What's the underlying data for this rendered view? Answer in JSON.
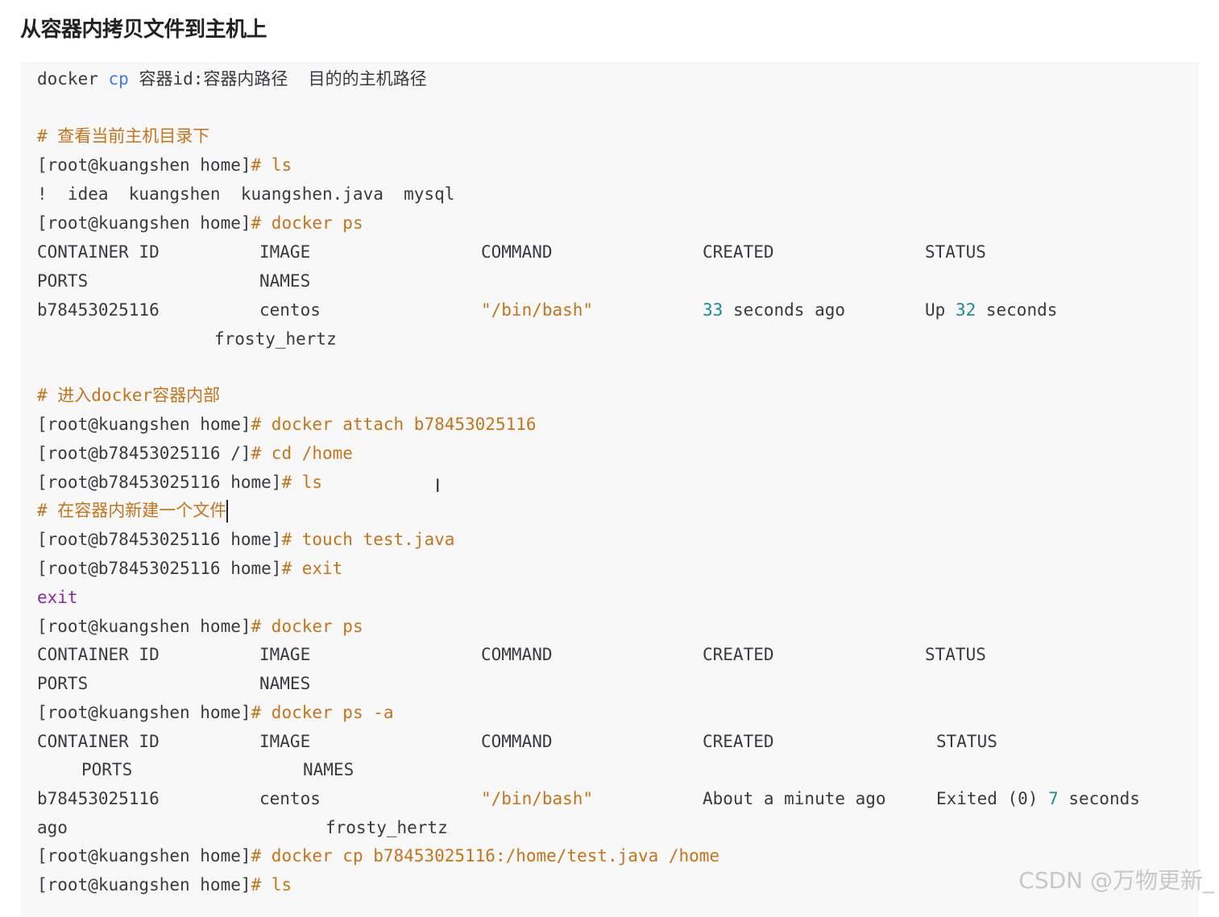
{
  "heading": "从容器内拷贝文件到主机上",
  "code": {
    "l1": {
      "a": "docker ",
      "kw": "cp",
      "b": " 容器id:容器内路径  目的的主机路径"
    },
    "l2": "# 查看当前主机目录下",
    "l3": {
      "prompt": "[root@kuangshen home]",
      "cmd": "# ls"
    },
    "l4": "!  idea  kuangshen  kuangshen.java  mysql",
    "l5": {
      "prompt": "[root@kuangshen home]",
      "cmd": "# docker ps"
    },
    "hdr": {
      "c1": "CONTAINER ID",
      "c2": "IMAGE",
      "c3": "COMMAND",
      "c4": "CREATED",
      "c5": "STATUS",
      "c6": "PORTS",
      "c7": "NAMES"
    },
    "row1": {
      "id": "b78453025116",
      "image": "centos",
      "command": "\"/bin/bash\"",
      "created_num": "33",
      "created_txt": " seconds ago",
      "status_a": "Up ",
      "status_num": "32",
      "status_b": " seconds",
      "name": "frosty_hertz"
    },
    "l6": "# 进入docker容器内部",
    "l7": {
      "prompt": "[root@kuangshen home]",
      "cmd": "# docker attach b78453025116"
    },
    "l8": {
      "prompt": "[root@b78453025116 /]",
      "cmd": "# cd /home"
    },
    "l9": {
      "prompt": "[root@b78453025116 home]",
      "cmd": "# ls"
    },
    "l10": "# 在容器内新建一个文件",
    "l11": {
      "prompt": "[root@b78453025116 home]",
      "cmd": "# touch test.java"
    },
    "l12": {
      "prompt": "[root@b78453025116 home]",
      "cmd": "# exit"
    },
    "l13": "exit",
    "l14": {
      "prompt": "[root@kuangshen home]",
      "cmd": "# docker ps"
    },
    "l15": {
      "prompt": "[root@kuangshen home]",
      "cmd": "# docker ps -a"
    },
    "row2": {
      "id": "b78453025116",
      "image": "centos",
      "command": "\"/bin/bash\"",
      "created": "About a minute ago",
      "status_a": "Exited (0) ",
      "status_num": "7",
      "status_b": " seconds",
      "ago": "ago",
      "name": "frosty_hertz"
    },
    "l16": {
      "prompt": "[root@kuangshen home]",
      "cmd": "# docker cp b78453025116:/home/test.java /home"
    },
    "l17": {
      "prompt": "[root@kuangshen home]",
      "cmd": "# ls"
    }
  },
  "watermark": "CSDN @万物更新_",
  "cursor_glyph": "I"
}
